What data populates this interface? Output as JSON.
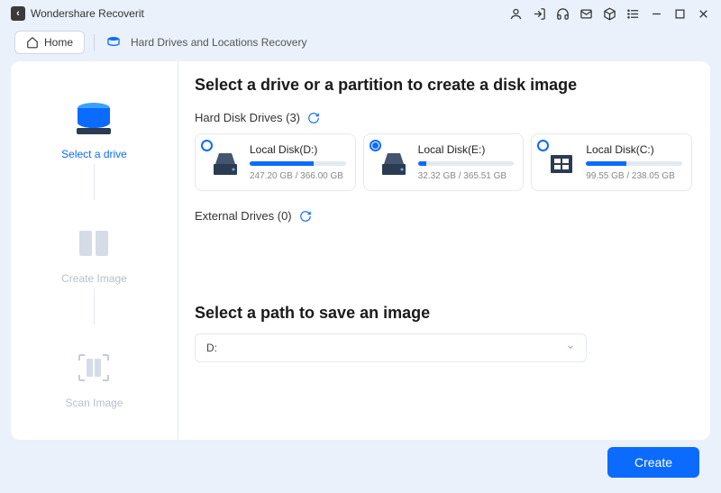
{
  "app": {
    "title": "Wondershare Recoverit"
  },
  "header": {
    "home_label": "Home",
    "breadcrumb": "Hard Drives and Locations Recovery"
  },
  "sidebar": {
    "steps": [
      {
        "label": "Select a drive"
      },
      {
        "label": "Create Image"
      },
      {
        "label": "Scan Image"
      }
    ]
  },
  "main": {
    "title": "Select a drive or a partition to create a disk image",
    "hdd_label": "Hard Disk Drives (3)",
    "external_label": "External Drives (0)",
    "drives": [
      {
        "name": "Local Disk(D:)",
        "usage": "247.20 GB / 366.00 GB",
        "fill": 67,
        "selected": false,
        "type": "hdd"
      },
      {
        "name": "Local Disk(E:)",
        "usage": "32.32 GB / 365.51 GB",
        "fill": 9,
        "selected": true,
        "type": "hdd"
      },
      {
        "name": "Local Disk(C:)",
        "usage": "99.55 GB / 238.05 GB",
        "fill": 42,
        "selected": false,
        "type": "win"
      }
    ],
    "path_title": "Select a path to save an image",
    "path_value": "D:"
  },
  "footer": {
    "create_label": "Create"
  }
}
